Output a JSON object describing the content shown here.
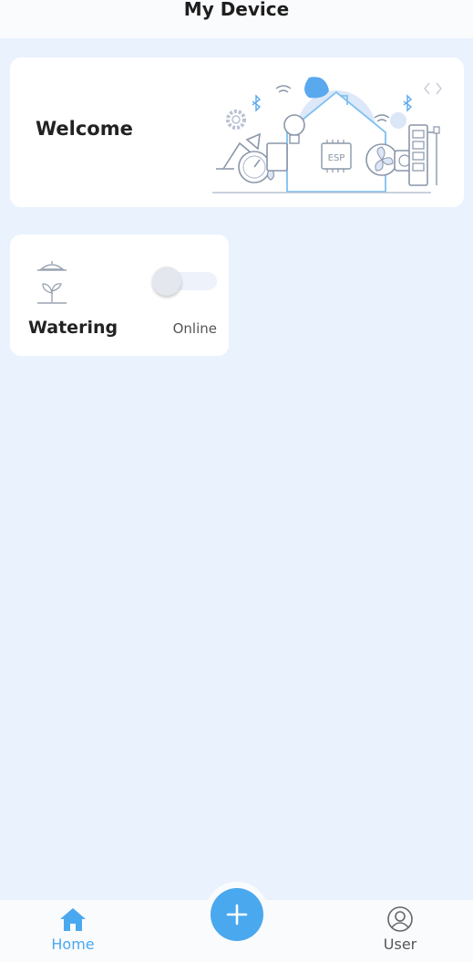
{
  "header": {
    "title": "My Device"
  },
  "welcome_card": {
    "title": "Welcome",
    "illustration_chip_label": "ESP"
  },
  "devices": [
    {
      "name": "Watering",
      "status": "Online",
      "icon": "watering-plant-icon",
      "toggle_on": false
    }
  ],
  "bottom_nav": {
    "items": [
      {
        "label": "Home",
        "icon": "home-icon",
        "active": true
      },
      {
        "label": "User",
        "icon": "user-icon",
        "active": false
      }
    ],
    "fab_icon": "plus-icon"
  },
  "colors": {
    "accent": "#4aa8ee",
    "background": "#eaf2fe",
    "card": "#ffffff",
    "header": "#fafbfd"
  }
}
